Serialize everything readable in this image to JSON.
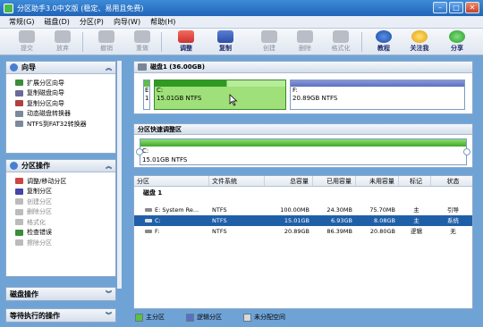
{
  "window": {
    "title": "分区助手3.0中文版 (稳定、易用且免费)"
  },
  "menu": [
    "常规(G)",
    "磁盘(D)",
    "分区(P)",
    "向导(W)",
    "帮助(H)"
  ],
  "toolbar": {
    "commit": "提交",
    "discard": "放弃",
    "undo": "撤销",
    "redo": "重做",
    "adjust": "调整",
    "copy": "复制",
    "create": "创建",
    "delete": "删除",
    "format": "格式化",
    "tutorial": "教程",
    "follow_us": "关注我",
    "share": "分享"
  },
  "sidebar": {
    "wizard": {
      "title": "向导",
      "items": [
        "扩展分区向导",
        "复制磁盘向导",
        "复制分区向导",
        "动态磁盘转换器",
        "NTFS到FAT32转换器"
      ]
    },
    "partition_ops": {
      "title": "分区操作",
      "items": [
        "调整/移动分区",
        "复制分区",
        "创建分区",
        "删除分区",
        "格式化",
        "检查错误",
        "擦除分区"
      ]
    },
    "disk_ops": {
      "title": "磁盘操作"
    },
    "pending_ops": {
      "title": "等待执行的操作"
    }
  },
  "disk_map": {
    "title": "磁盘1 (36.00GB)",
    "partitions": [
      {
        "letter": "E",
        "num": "1",
        "size_line": ""
      },
      {
        "letter": "C:",
        "size_line": "15.01GB NTFS"
      },
      {
        "letter": "F:",
        "size_line": "20.89GB NTFS"
      }
    ]
  },
  "resize": {
    "title": "分区快速调整区",
    "letter": "C:",
    "size_line": "15.01GB NTFS"
  },
  "table": {
    "headers": [
      "分区",
      "文件系统",
      "总容量",
      "已用容量",
      "未用容量",
      "标记",
      "状态"
    ],
    "disk_label": "磁盘 1",
    "rows": [
      {
        "name": "E: System Re...",
        "fs": "NTFS",
        "total": "100.00MB",
        "used": "24.30MB",
        "free": "75.70MB",
        "flag": "主",
        "status": "引导"
      },
      {
        "name": "C:",
        "fs": "NTFS",
        "total": "15.01GB",
        "used": "6.93GB",
        "free": "8.08GB",
        "flag": "主",
        "status": "系统"
      },
      {
        "name": "F:",
        "fs": "NTFS",
        "total": "20.89GB",
        "used": "86.39MB",
        "free": "20.80GB",
        "flag": "逻辑",
        "status": "无"
      }
    ]
  },
  "legend": {
    "primary": "主分区",
    "logical": "逻辑分区",
    "unallocated": "未分配空间"
  },
  "colors": {
    "primary": "#5cc040",
    "logical": "#5b6fc2",
    "unallocated": "#d8d8d8",
    "selection": "#1f5fa8"
  },
  "window_buttons": {
    "minimize": "–",
    "maximize": "□",
    "close": "✕"
  }
}
